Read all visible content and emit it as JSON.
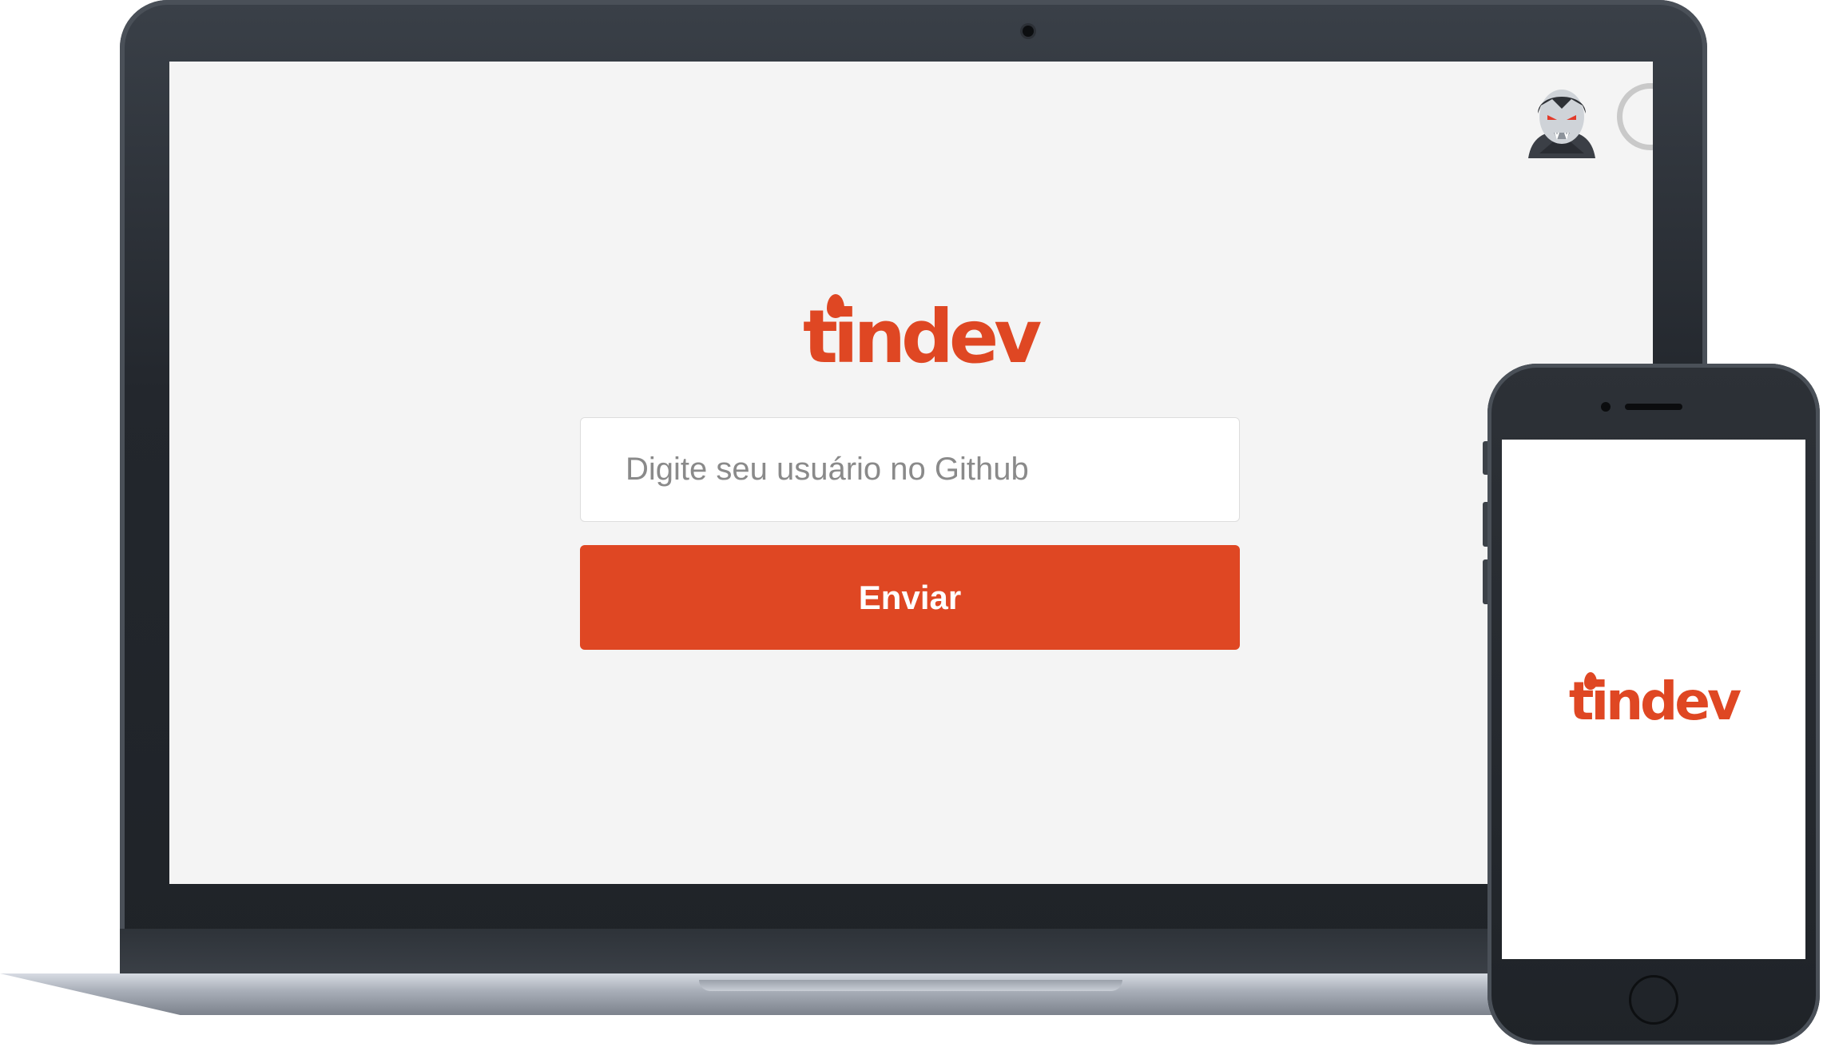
{
  "app": {
    "logo_text": "tindev",
    "brand_color": "#df4723",
    "background_color": "#f4f4f4"
  },
  "login_form": {
    "username_placeholder": "Digite seu usuário no Github",
    "username_value": "",
    "submit_label": "Enviar"
  },
  "header": {
    "avatar_icon": "vampire-avatar-icon",
    "spinner_icon": "loading-spinner-icon"
  },
  "phone": {
    "logo_text": "tindev",
    "screen_color": "#ffffff"
  }
}
